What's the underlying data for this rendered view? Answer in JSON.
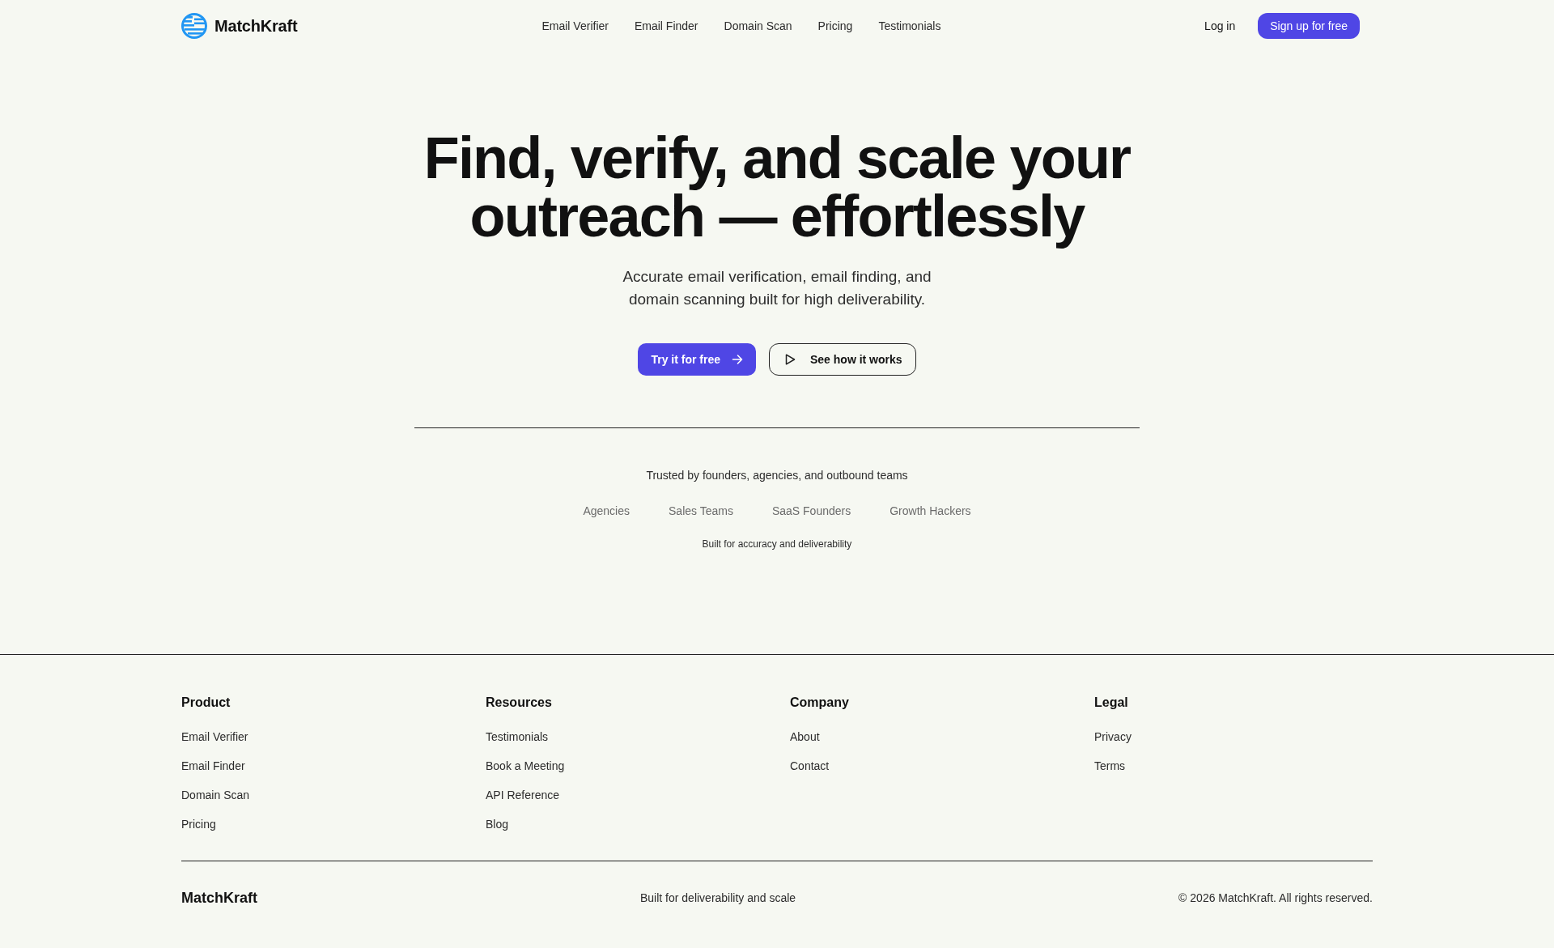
{
  "header": {
    "brand": "MatchKraft",
    "nav": [
      "Email Verifier",
      "Email Finder",
      "Domain Scan",
      "Pricing",
      "Testimonials"
    ],
    "login": "Log in",
    "signup": "Sign up for free"
  },
  "hero": {
    "title": "Find, verify, and scale your outreach — effortlessly",
    "subtitle": "Accurate email verification, email finding, and domain scanning built for high deliverability.",
    "buttons": [
      {
        "label": "Try it for free",
        "kind": "primary"
      },
      {
        "label": "See how it works",
        "kind": "secondary"
      }
    ]
  },
  "trust": {
    "heading": "Trusted by founders, agencies, and outbound teams",
    "audiences": [
      "Agencies",
      "Sales Teams",
      "SaaS Founders",
      "Growth Hackers"
    ],
    "note": "Built for accuracy and deliverability"
  },
  "footer": {
    "columns": [
      {
        "heading": "Product",
        "links": [
          "Email Verifier",
          "Email Finder",
          "Domain Scan",
          "Pricing"
        ]
      },
      {
        "heading": "Resources",
        "links": [
          "Testimonials",
          "Book a Meeting",
          "API Reference",
          "Blog"
        ]
      },
      {
        "heading": "Company",
        "links": [
          "About",
          "Contact"
        ]
      },
      {
        "heading": "Legal",
        "links": [
          "Privacy",
          "Terms"
        ]
      }
    ],
    "brand": "MatchKraft",
    "tagline": "Built for deliverability and scale",
    "copyright": "© 2026 MatchKraft. All rights reserved."
  }
}
